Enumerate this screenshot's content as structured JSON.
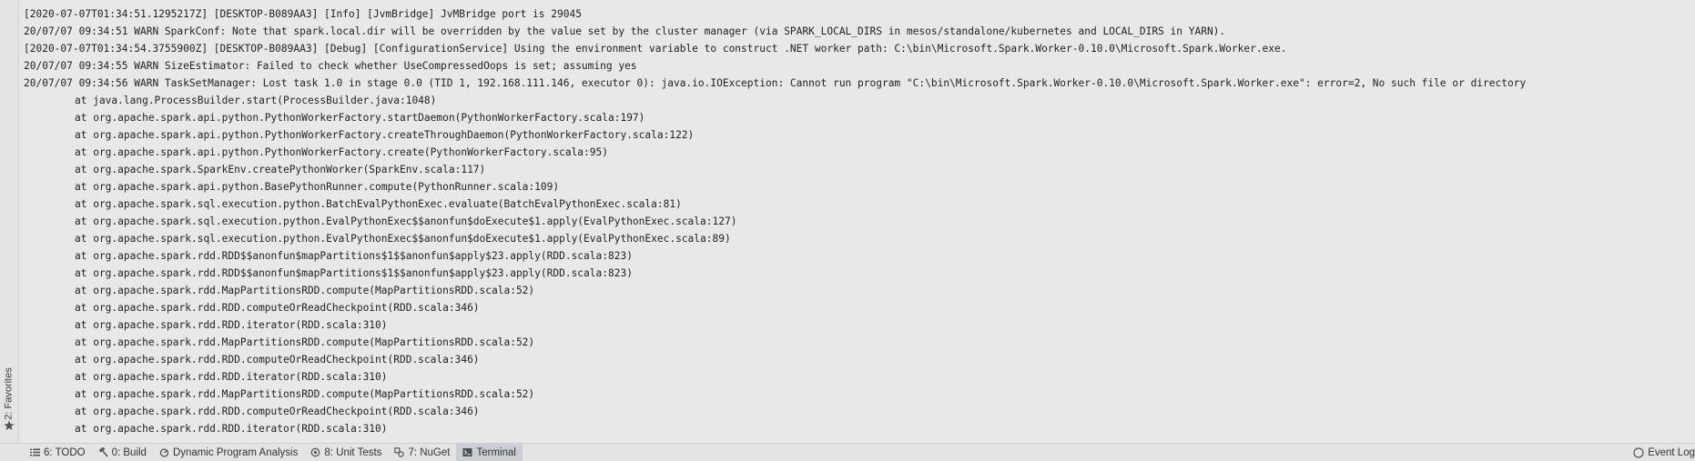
{
  "log_lines": [
    "[2020-07-07T01:34:51.1295217Z] [DESKTOP-B089AA3] [Info] [JvmBridge] JvMBridge port is 29045",
    "20/07/07 09:34:51 WARN SparkConf: Note that spark.local.dir will be overridden by the value set by the cluster manager (via SPARK_LOCAL_DIRS in mesos/standalone/kubernetes and LOCAL_DIRS in YARN).",
    "[2020-07-07T01:34:54.3755900Z] [DESKTOP-B089AA3] [Debug] [ConfigurationService] Using the environment variable to construct .NET worker path: C:\\bin\\Microsoft.Spark.Worker-0.10.0\\Microsoft.Spark.Worker.exe.",
    "20/07/07 09:34:55 WARN SizeEstimator: Failed to check whether UseCompressedOops is set; assuming yes",
    "20/07/07 09:34:56 WARN TaskSetManager: Lost task 1.0 in stage 0.0 (TID 1, 192.168.111.146, executor 0): java.io.IOException: Cannot run program \"C:\\bin\\Microsoft.Spark.Worker-0.10.0\\Microsoft.Spark.Worker.exe\": error=2, No such file or directory"
  ],
  "stack_trace": [
    "at java.lang.ProcessBuilder.start(ProcessBuilder.java:1048)",
    "at org.apache.spark.api.python.PythonWorkerFactory.startDaemon(PythonWorkerFactory.scala:197)",
    "at org.apache.spark.api.python.PythonWorkerFactory.createThroughDaemon(PythonWorkerFactory.scala:122)",
    "at org.apache.spark.api.python.PythonWorkerFactory.create(PythonWorkerFactory.scala:95)",
    "at org.apache.spark.SparkEnv.createPythonWorker(SparkEnv.scala:117)",
    "at org.apache.spark.api.python.BasePythonRunner.compute(PythonRunner.scala:109)",
    "at org.apache.spark.sql.execution.python.BatchEvalPythonExec.evaluate(BatchEvalPythonExec.scala:81)",
    "at org.apache.spark.sql.execution.python.EvalPythonExec$$anonfun$doExecute$1.apply(EvalPythonExec.scala:127)",
    "at org.apache.spark.sql.execution.python.EvalPythonExec$$anonfun$doExecute$1.apply(EvalPythonExec.scala:89)",
    "at org.apache.spark.rdd.RDD$$anonfun$mapPartitions$1$$anonfun$apply$23.apply(RDD.scala:823)",
    "at org.apache.spark.rdd.RDD$$anonfun$mapPartitions$1$$anonfun$apply$23.apply(RDD.scala:823)",
    "at org.apache.spark.rdd.MapPartitionsRDD.compute(MapPartitionsRDD.scala:52)",
    "at org.apache.spark.rdd.RDD.computeOrReadCheckpoint(RDD.scala:346)",
    "at org.apache.spark.rdd.RDD.iterator(RDD.scala:310)",
    "at org.apache.spark.rdd.MapPartitionsRDD.compute(MapPartitionsRDD.scala:52)",
    "at org.apache.spark.rdd.RDD.computeOrReadCheckpoint(RDD.scala:346)",
    "at org.apache.spark.rdd.RDD.iterator(RDD.scala:310)",
    "at org.apache.spark.rdd.MapPartitionsRDD.compute(MapPartitionsRDD.scala:52)",
    "at org.apache.spark.rdd.RDD.computeOrReadCheckpoint(RDD.scala:346)",
    "at org.apache.spark.rdd.RDD.iterator(RDD.scala:310)"
  ],
  "side_panel": {
    "favorites_label": "2: Favorites",
    "favorites_icon": "star-icon"
  },
  "tool_tabs": [
    {
      "label": "6: TODO",
      "icon": "list-icon",
      "active": false
    },
    {
      "label": "0: Build",
      "icon": "hammer-icon",
      "active": false
    },
    {
      "label": "Dynamic Program Analysis",
      "icon": "analysis-icon",
      "active": false
    },
    {
      "label": "8: Unit Tests",
      "icon": "unit-tests-icon",
      "active": false
    },
    {
      "label": "7: NuGet",
      "icon": "nuget-icon",
      "active": false
    },
    {
      "label": "Terminal",
      "icon": "terminal-icon",
      "active": true
    }
  ],
  "event_log": {
    "label": "Event Log",
    "icon": "event-log-icon"
  },
  "colors": {
    "background": "#e8e8e8",
    "text": "#222222",
    "active_tab": "#cbcfd4",
    "toolbar": "#e4e4e4"
  }
}
